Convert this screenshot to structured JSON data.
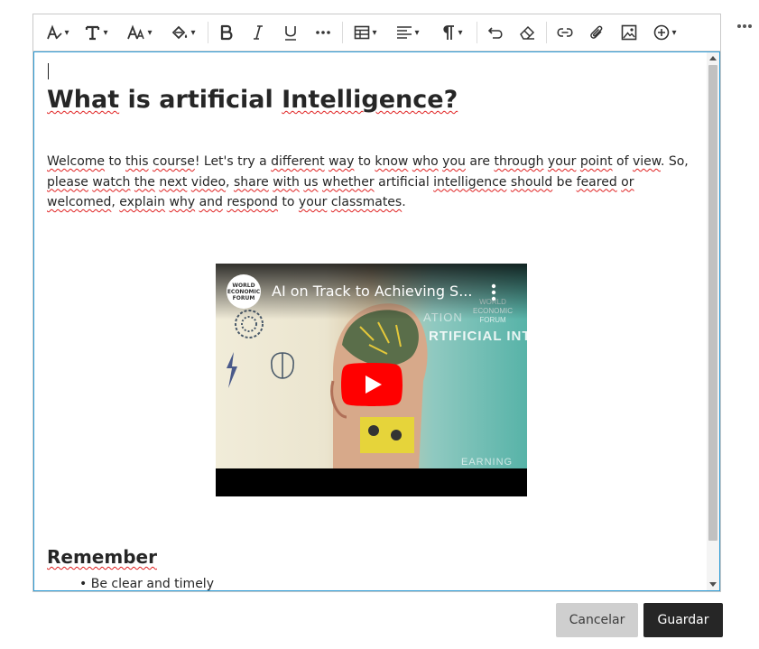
{
  "toolbar": {
    "items": [
      {
        "name": "text-style",
        "has_dropdown": true
      },
      {
        "name": "font-family",
        "has_dropdown": true
      },
      {
        "name": "font-size",
        "has_dropdown": true
      },
      {
        "name": "text-color",
        "has_dropdown": true
      },
      {
        "name": "bold"
      },
      {
        "name": "italic"
      },
      {
        "name": "underline"
      },
      {
        "name": "more-formatting"
      },
      {
        "name": "table",
        "has_dropdown": true
      },
      {
        "name": "align",
        "has_dropdown": true
      },
      {
        "name": "paragraph",
        "has_dropdown": true
      },
      {
        "name": "undo"
      },
      {
        "name": "clear-formatting"
      },
      {
        "name": "link"
      },
      {
        "name": "attach"
      },
      {
        "name": "image"
      },
      {
        "name": "insert",
        "has_dropdown": true
      }
    ],
    "dropdown_caret": "▾"
  },
  "content": {
    "title_words": [
      "What",
      "is",
      "artificial",
      "Intelligence?"
    ],
    "title": "What is artificial Intelligence?",
    "paragraph": {
      "segments": [
        {
          "t": "Welcome",
          "sp": true
        },
        {
          "t": " to "
        },
        {
          "t": "this",
          "sp": true
        },
        {
          "t": " "
        },
        {
          "t": "course",
          "sp": true
        },
        {
          "t": "! Let's try a "
        },
        {
          "t": "different",
          "sp": true
        },
        {
          "t": " "
        },
        {
          "t": "way",
          "sp": true
        },
        {
          "t": " to "
        },
        {
          "t": "know",
          "sp": true
        },
        {
          "t": " "
        },
        {
          "t": "who",
          "sp": true
        },
        {
          "t": " "
        },
        {
          "t": "you",
          "sp": true
        },
        {
          "t": " are "
        },
        {
          "t": "through",
          "sp": true
        },
        {
          "t": " "
        },
        {
          "t": "your",
          "sp": true
        },
        {
          "t": " "
        },
        {
          "t": "point",
          "sp": true
        },
        {
          "t": " of "
        },
        {
          "t": "view",
          "sp": true
        },
        {
          "t": ". So, "
        },
        {
          "t": "please",
          "sp": true
        },
        {
          "t": " "
        },
        {
          "t": "watch",
          "sp": true
        },
        {
          "t": " "
        },
        {
          "t": "the",
          "sp": true
        },
        {
          "t": " "
        },
        {
          "t": "next",
          "sp": true
        },
        {
          "t": " "
        },
        {
          "t": "video",
          "sp": true
        },
        {
          "t": ", "
        },
        {
          "t": "share",
          "sp": true
        },
        {
          "t": " "
        },
        {
          "t": "with",
          "sp": true
        },
        {
          "t": " "
        },
        {
          "t": "us",
          "sp": true
        },
        {
          "t": " "
        },
        {
          "t": "whether",
          "sp": true
        },
        {
          "t": " artificial "
        },
        {
          "t": "intelligence",
          "sp": true
        },
        {
          "t": " "
        },
        {
          "t": "should",
          "sp": true
        },
        {
          "t": " be "
        },
        {
          "t": "feared",
          "sp": true
        },
        {
          "t": " "
        },
        {
          "t": "or",
          "sp": true
        },
        {
          "t": " "
        },
        {
          "t": "welcomed",
          "sp": true
        },
        {
          "t": ", "
        },
        {
          "t": "explain",
          "sp": true
        },
        {
          "t": " "
        },
        {
          "t": "why",
          "sp": true
        },
        {
          "t": " "
        },
        {
          "t": "and",
          "sp": true
        },
        {
          "t": " "
        },
        {
          "t": "respond",
          "sp": true
        },
        {
          "t": " to "
        },
        {
          "t": "your",
          "sp": true
        },
        {
          "t": " "
        },
        {
          "t": "classmates",
          "sp": true
        },
        {
          "t": "."
        }
      ]
    },
    "video": {
      "title": "AI on Track to Achieving S...",
      "channel_logo": "WORLD ECONOMIC FORUM",
      "thumb_text_1": "ATION",
      "thumb_text_2": "RTIFICIAL INT",
      "thumb_text_3": "EARNING",
      "thumb_logo": "WORLD ECONOMIC FORUM"
    },
    "remember_heading": "Remember",
    "bullet_bullet": "•",
    "bullet_words": [
      {
        "t": "Be "
      },
      {
        "t": "clear",
        "sp": true
      },
      {
        "t": " and timely",
        "sp2": true
      }
    ]
  },
  "buttons": {
    "cancel": "Cancelar",
    "save": "Guardar"
  },
  "colors": {
    "focus_border": "#2c9bd6",
    "spellcheck": "#e02020",
    "save_bg": "#262626",
    "cancel_bg": "#cfcfcf",
    "play_red": "#ff0000"
  }
}
